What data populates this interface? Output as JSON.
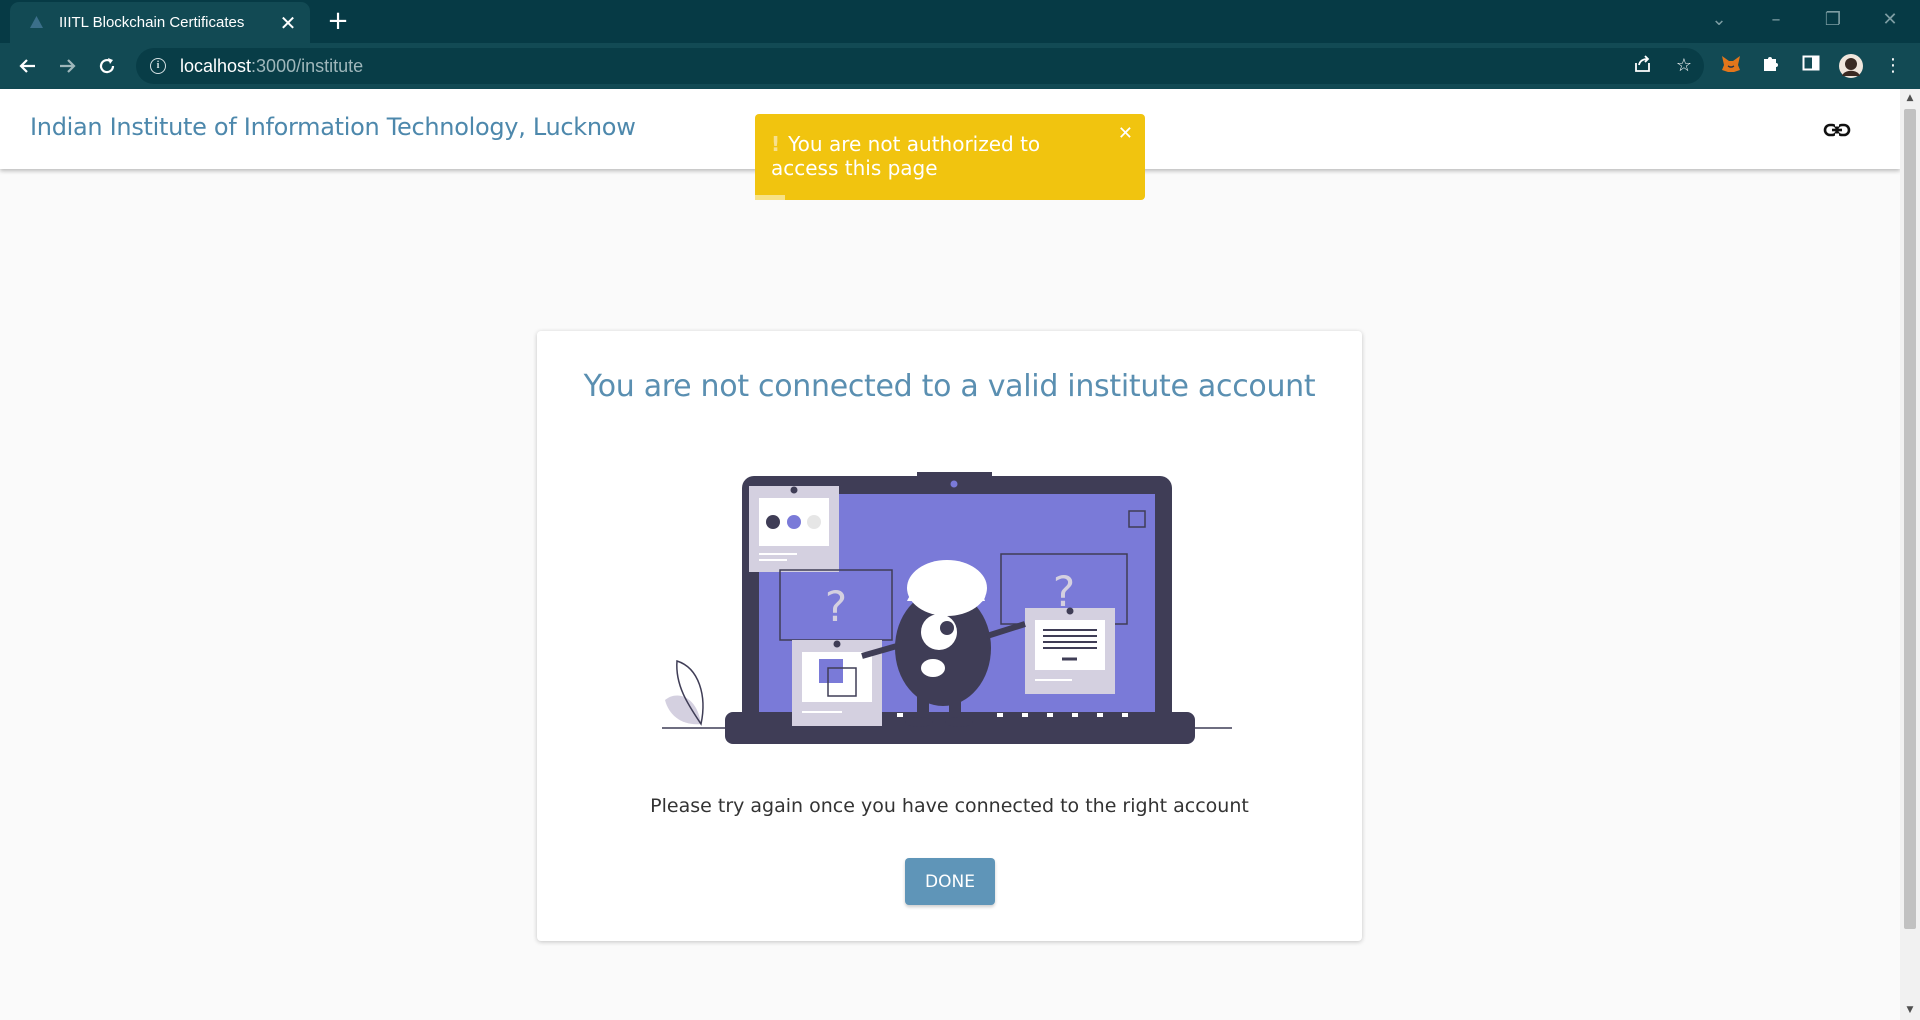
{
  "browser": {
    "tab_title": "IIITL Blockchain Certificates",
    "tab_close": "✕",
    "new_tab": "+",
    "url_host": "localhost",
    "url_path": ":3000/institute"
  },
  "header": {
    "brand": "Indian Institute of Information Technology, Lucknow"
  },
  "toast": {
    "message": "You are not authorized to access this page",
    "icon": "!",
    "close": "✕"
  },
  "card": {
    "title": "You are not connected to a valid institute account",
    "illustration_marks": [
      "?",
      "?"
    ],
    "message": "Please try again once you have connected to the right account",
    "button_label": "DONE"
  },
  "colors": {
    "chrome_dark": "#063a45",
    "chrome_toolbar": "#124a54",
    "brand_blue": "#4d88ac",
    "toast_yellow": "#f1c40f",
    "button_blue": "#5f95b8",
    "illustration_purple": "#7a7ad8",
    "illustration_dark": "#3f3d56"
  }
}
